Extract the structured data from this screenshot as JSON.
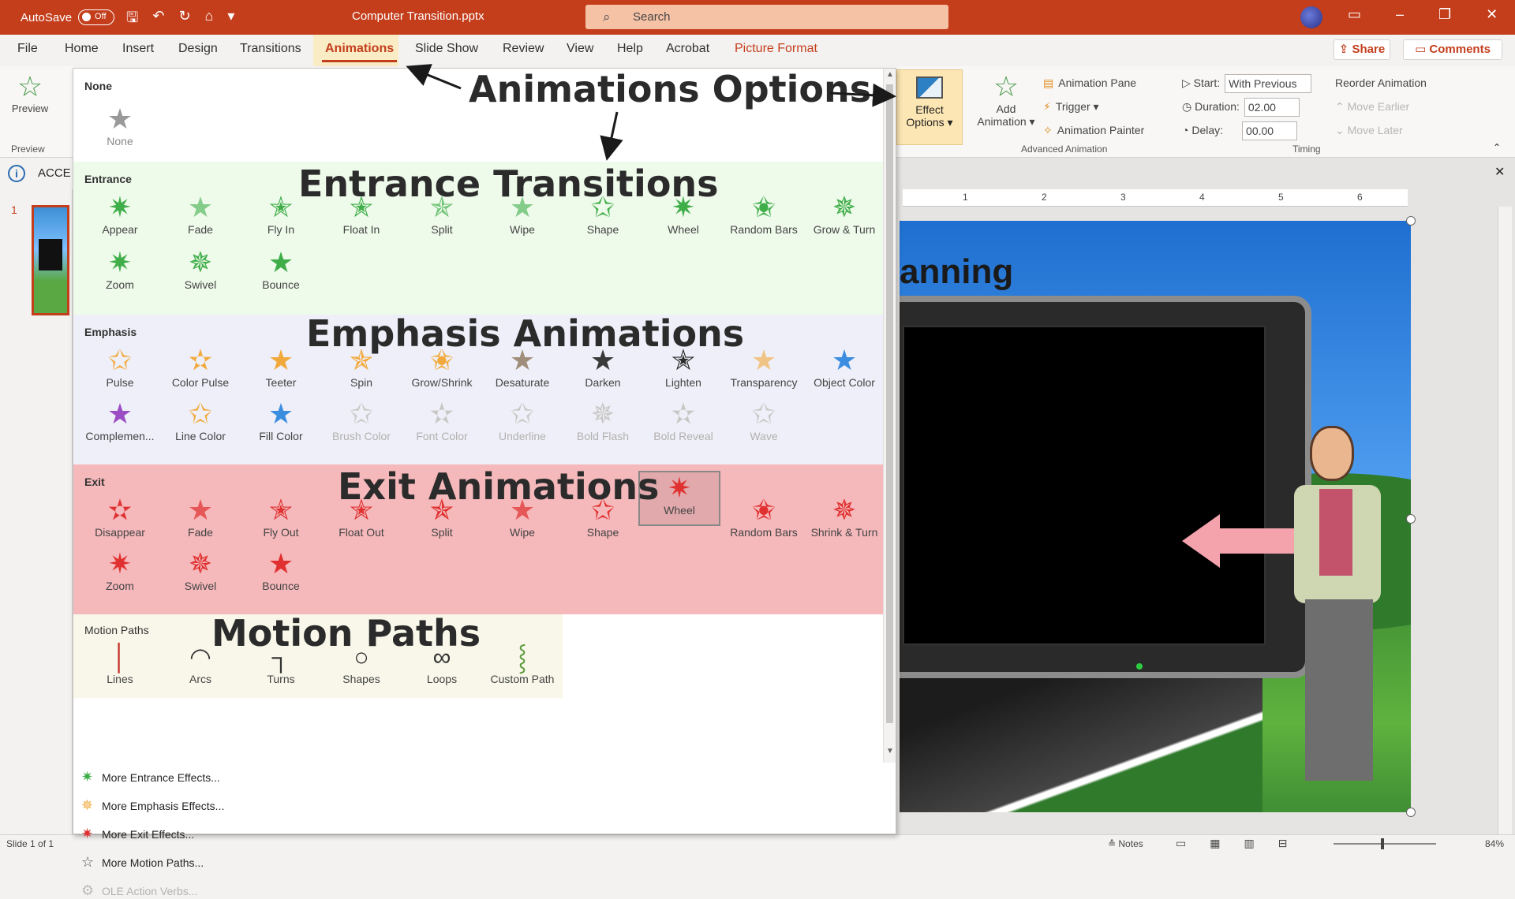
{
  "titlebar": {
    "autosave_label": "AutoSave",
    "autosave_state": "Off",
    "file_title": "Computer Transition.pptx",
    "search_placeholder": "Search"
  },
  "tabs": [
    "File",
    "Home",
    "Insert",
    "Design",
    "Transitions",
    "Animations",
    "Slide Show",
    "Review",
    "View",
    "Help",
    "Acrobat",
    "Picture Format"
  ],
  "active_tab": "Animations",
  "share_label": "Share",
  "comments_label": "Comments",
  "ribbon": {
    "preview_label": "Preview",
    "preview_group": "Preview",
    "effect_options": "Effect Options",
    "add_animation": "Add Animation",
    "advanced": {
      "pane": "Animation Pane",
      "trigger": "Trigger",
      "painter": "Animation Painter",
      "group_label": "Advanced Animation"
    },
    "timing": {
      "start_label": "Start:",
      "start_value": "With Previous",
      "duration_label": "Duration:",
      "duration_value": "02.00",
      "delay_label": "Delay:",
      "delay_value": "00.00",
      "group_label": "Timing"
    },
    "reorder": {
      "title": "Reorder Animation",
      "earlier": "Move Earlier",
      "later": "Move Later"
    }
  },
  "accessibility_bar": "ACCE",
  "thumb_number": "1",
  "gallery": {
    "none": {
      "title": "None",
      "items": [
        "None"
      ]
    },
    "entrance": {
      "title": "Entrance",
      "items": [
        "Appear",
        "Fade",
        "Fly In",
        "Float In",
        "Split",
        "Wipe",
        "Shape",
        "Wheel",
        "Random Bars",
        "Grow & Turn",
        "Zoom",
        "Swivel",
        "Bounce"
      ]
    },
    "emphasis": {
      "title": "Emphasis",
      "items": [
        "Pulse",
        "Color Pulse",
        "Teeter",
        "Spin",
        "Grow/Shrink",
        "Desaturate",
        "Darken",
        "Lighten",
        "Transparency",
        "Object Color",
        "Complemen...",
        "Line Color",
        "Fill Color",
        "Brush Color",
        "Font Color",
        "Underline",
        "Bold Flash",
        "Bold Reveal",
        "Wave"
      ],
      "disabled": [
        13,
        14,
        15,
        16,
        17,
        18
      ]
    },
    "exit": {
      "title": "Exit",
      "items": [
        "Disappear",
        "Fade",
        "Fly Out",
        "Float Out",
        "Split",
        "Wipe",
        "Shape",
        "Wheel",
        "Random Bars",
        "Shrink & Turn",
        "Zoom",
        "Swivel",
        "Bounce"
      ],
      "selected": 7
    },
    "motion": {
      "title": "Motion Paths",
      "items": [
        "Lines",
        "Arcs",
        "Turns",
        "Shapes",
        "Loops",
        "Custom Path"
      ]
    },
    "more": [
      "More Entrance Effects...",
      "More Emphasis Effects...",
      "More Exit Effects...",
      "More Motion Paths...",
      "OLE Action Verbs..."
    ]
  },
  "annotations": {
    "animations_options": "Animations Options",
    "entrance": "Entrance Transitions",
    "emphasis": "Emphasis Animations",
    "exit": "Exit Animations",
    "motion": "Motion Paths"
  },
  "slide": {
    "title_fragment": "anning"
  },
  "ruler_ticks": [
    "1",
    "2",
    "3",
    "4",
    "5",
    "6"
  ],
  "status": {
    "slide_of": "Slide 1 of 1",
    "notes": "Notes",
    "zoom": "84%"
  },
  "colors": {
    "accent": "#c43e1c",
    "entrance": "#3fae49",
    "emphasis": "#f2a93b",
    "exit": "#e0302f"
  }
}
